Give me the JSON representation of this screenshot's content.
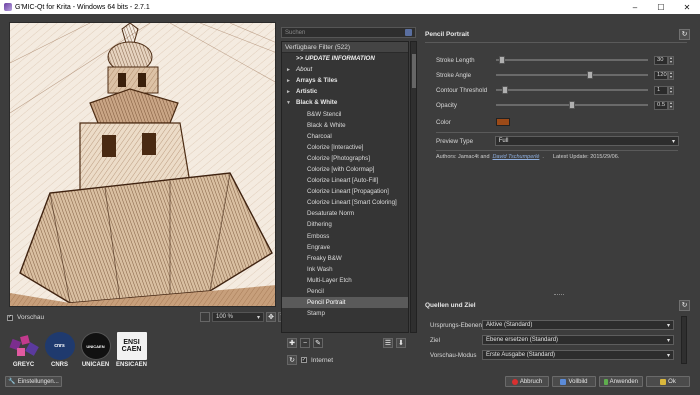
{
  "window": {
    "title": "G'MIC-Qt for Krita - Windows 64 bits - 2.7.1",
    "controls": [
      "–",
      "☐",
      "✕"
    ]
  },
  "preview": {
    "vorschau_label": "Vorschau",
    "vorschau_checked": true,
    "zoom": "100 %"
  },
  "logos": [
    {
      "name": "GREYC"
    },
    {
      "name": "CNRS",
      "mark": "cnrs"
    },
    {
      "name": "UNICAEN",
      "mark": "UNICAEN"
    },
    {
      "name": "ENSICAEN",
      "mark": "ENSI CAEN"
    }
  ],
  "settings_button": "Einstellungen...",
  "filters": {
    "search_placeholder": "Suchen",
    "header": "Verfügbare Filter (522)",
    "items": [
      {
        "label": ">> UPDATE INFORMATION",
        "kind": "update"
      },
      {
        "label": "About",
        "kind": "cat-italic",
        "arrow": "►"
      },
      {
        "label": "Arrays & Tiles",
        "kind": "cat",
        "arrow": "►"
      },
      {
        "label": "Artistic",
        "kind": "cat",
        "arrow": "►"
      },
      {
        "label": "Black & White",
        "kind": "cat",
        "arrow": "▼"
      },
      {
        "label": "B&W Stencil",
        "kind": "sub"
      },
      {
        "label": "Black & White",
        "kind": "sub"
      },
      {
        "label": "Charcoal",
        "kind": "sub"
      },
      {
        "label": "Colorize [Interactive]",
        "kind": "sub"
      },
      {
        "label": "Colorize [Photographs]",
        "kind": "sub"
      },
      {
        "label": "Colorize [with Colormap]",
        "kind": "sub"
      },
      {
        "label": "Colorize Lineart [Auto-Fill]",
        "kind": "sub"
      },
      {
        "label": "Colorize Lineart [Propagation]",
        "kind": "sub"
      },
      {
        "label": "Colorize Lineart [Smart Coloring]",
        "kind": "sub"
      },
      {
        "label": "Desaturate Norm",
        "kind": "sub"
      },
      {
        "label": "Dithering",
        "kind": "sub"
      },
      {
        "label": "Emboss",
        "kind": "sub"
      },
      {
        "label": "Engrave",
        "kind": "sub"
      },
      {
        "label": "Freaky B&W",
        "kind": "sub"
      },
      {
        "label": "Ink Wash",
        "kind": "sub"
      },
      {
        "label": "Multi-Layer Etch",
        "kind": "sub"
      },
      {
        "label": "Pencil",
        "kind": "sub"
      },
      {
        "label": "Pencil Portrait",
        "kind": "sub",
        "selected": true
      },
      {
        "label": "Stamp",
        "kind": "sub"
      }
    ],
    "internet_label": "Internet",
    "internet_checked": true
  },
  "filter_panel": {
    "title": "Pencil Portrait",
    "params": [
      {
        "label": "Stroke Length",
        "value": "30",
        "fraction": 0.02
      },
      {
        "label": "Stroke Angle",
        "value": "120",
        "fraction": 0.62
      },
      {
        "label": "Contour Threshold",
        "value": "1",
        "fraction": 0.04
      },
      {
        "label": "Opacity",
        "value": "0.5",
        "fraction": 0.5
      }
    ],
    "color_label": "Color",
    "color_value": "#9b4a18",
    "preview_type_label": "Preview Type",
    "preview_type_value": "Full",
    "authors_prefix": "Authors: Jamac4t and",
    "authors_link": "David Tschumperlé",
    "authors_suffix": ".",
    "latest_update": "Latest Update: 2015/29/06."
  },
  "io": {
    "title": "Quellen und Ziel",
    "rows": [
      {
        "label": "Ursprungs-Ebenen",
        "value": "Aktive (Standard)"
      },
      {
        "label": "Ziel",
        "value": "Ebene ersetzen (Standard)"
      },
      {
        "label": "Vorschau-Modus",
        "value": "Erste Ausgabe (Standard)"
      }
    ]
  },
  "buttons": {
    "abbruch": "Abbruch",
    "vollbild": "Vollbild",
    "anwenden": "Anwenden",
    "ok": "Ok"
  },
  "colors": {
    "background": "#3d3d3d",
    "selection": "#5a5a5a",
    "sepia": "#9b4a18"
  }
}
